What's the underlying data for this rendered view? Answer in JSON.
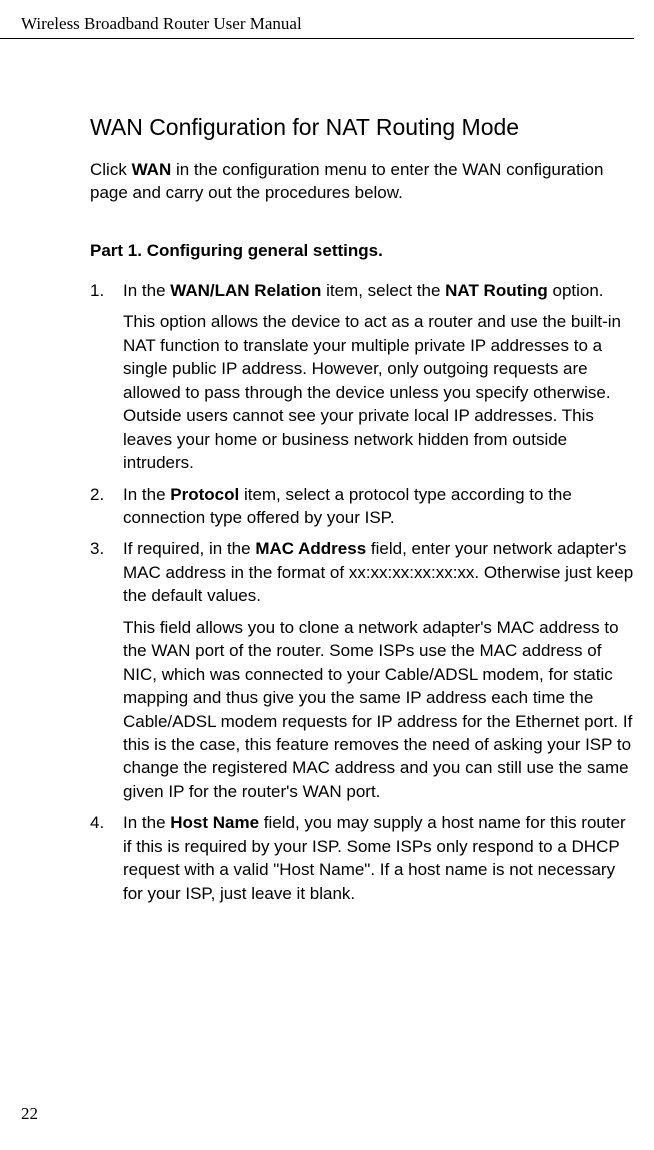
{
  "header": {
    "title": "Wireless Broadband Router User Manual"
  },
  "page_number": "22",
  "section": {
    "title": "WAN Configuration for NAT Routing Mode",
    "intro_pre": "Click ",
    "intro_bold": "WAN",
    "intro_post": " in the configuration menu to enter the WAN configuration page and carry out the procedures below."
  },
  "part": {
    "title": "Part 1. Configuring general settings."
  },
  "items": [
    {
      "num": "1.",
      "pre": "In the ",
      "bold1": "WAN/LAN Relation",
      "mid": " item, select the ",
      "bold2": "NAT Routing",
      "post": " option.",
      "para2": "This option allows the device to act as a router and use the built-in NAT function to translate your multiple private IP addresses to a single public IP address. However, only outgoing requests are allowed to pass through the device unless you specify otherwise. Outside users cannot see your private local IP addresses. This leaves your home or business network hidden from outside intruders."
    },
    {
      "num": "2.",
      "pre": "In the ",
      "bold1": "Protocol",
      "post": " item, select a protocol type according to the connection type offered by your ISP."
    },
    {
      "num": "3.",
      "pre": "If required, in the ",
      "bold1": "MAC Address",
      "post": " field, enter your network adapter's MAC address in the format of xx:xx:xx:xx:xx:xx. Otherwise just keep the default values.",
      "para2": "This field allows you to clone a network adapter's MAC address to the WAN port of the router. Some ISPs use the MAC address of NIC, which was connected to your Cable/ADSL modem, for static mapping and thus give you the same IP address each time the Cable/ADSL modem requests for IP address for the Ethernet port. If this is the case, this feature removes the need of asking your ISP to change the registered MAC address and you can still use the same given IP for the router's WAN port."
    },
    {
      "num": "4.",
      "pre": "In the ",
      "bold1": "Host Name",
      "post": " field, you may supply a host name for this router if this is required by your ISP. Some ISPs only respond to a DHCP request with a valid \"Host Name\". If a host name is not necessary for your ISP, just leave it blank."
    }
  ]
}
